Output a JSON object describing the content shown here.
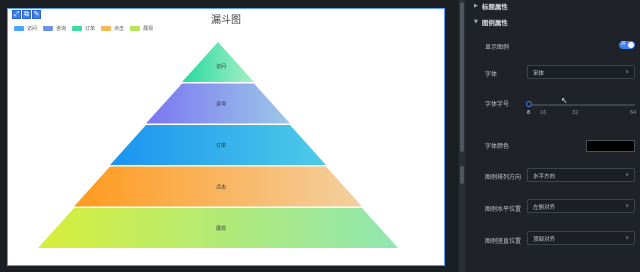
{
  "chart_card": {
    "toolbar_buttons": [
      "⤢",
      "⧉",
      "✎"
    ],
    "title": "漏斗图"
  },
  "legend": [
    {
      "label": "访问",
      "color": "#4aa3ff"
    },
    {
      "label": "咨询",
      "color": "#6f8ff0"
    },
    {
      "label": "订单",
      "color": "#3ddba0"
    },
    {
      "label": "点击",
      "color": "#f7b955"
    },
    {
      "label": "展现",
      "color": "#b7e35c"
    }
  ],
  "chart_data": {
    "type": "funnel",
    "title": "漏斗图",
    "layers": [
      {
        "name": "访问",
        "label": "访问",
        "value": 20,
        "from": "#26d9a0",
        "to": "#a9f0c6"
      },
      {
        "name": "咨询",
        "label": "咨询",
        "value": 40,
        "from": "#7b75f0",
        "to": "#9cc8e8"
      },
      {
        "name": "订单",
        "label": "订单",
        "value": 60,
        "from": "#1a93f0",
        "to": "#4ecbe8"
      },
      {
        "name": "点击",
        "label": "点击",
        "value": 80,
        "from": "#ff9a1e",
        "to": "#f3d0a0"
      },
      {
        "name": "展现",
        "label": "展现",
        "value": 100,
        "from": "#d8ef3a",
        "to": "#8fe6b3"
      }
    ]
  },
  "panel": {
    "section_title_top": "标题属性",
    "section_title": "图例属性",
    "show_legend_label": "显示图例",
    "show_legend_toggle": "开",
    "font_label": "字体",
    "font_value": "宋体",
    "font_size_label": "字体字号",
    "font_size_value": 8,
    "font_size_ticks": [
      "8",
      "16",
      "32",
      "64"
    ],
    "font_color_label": "字体颜色",
    "font_color_value": "#000000",
    "legend_direction_label": "图例排列方向",
    "legend_direction_value": "水平方向",
    "legend_h_label": "图例水平位置",
    "legend_h_value": "左侧对齐",
    "legend_v_label": "图例竖直位置",
    "legend_v_value": "顶部对齐"
  }
}
